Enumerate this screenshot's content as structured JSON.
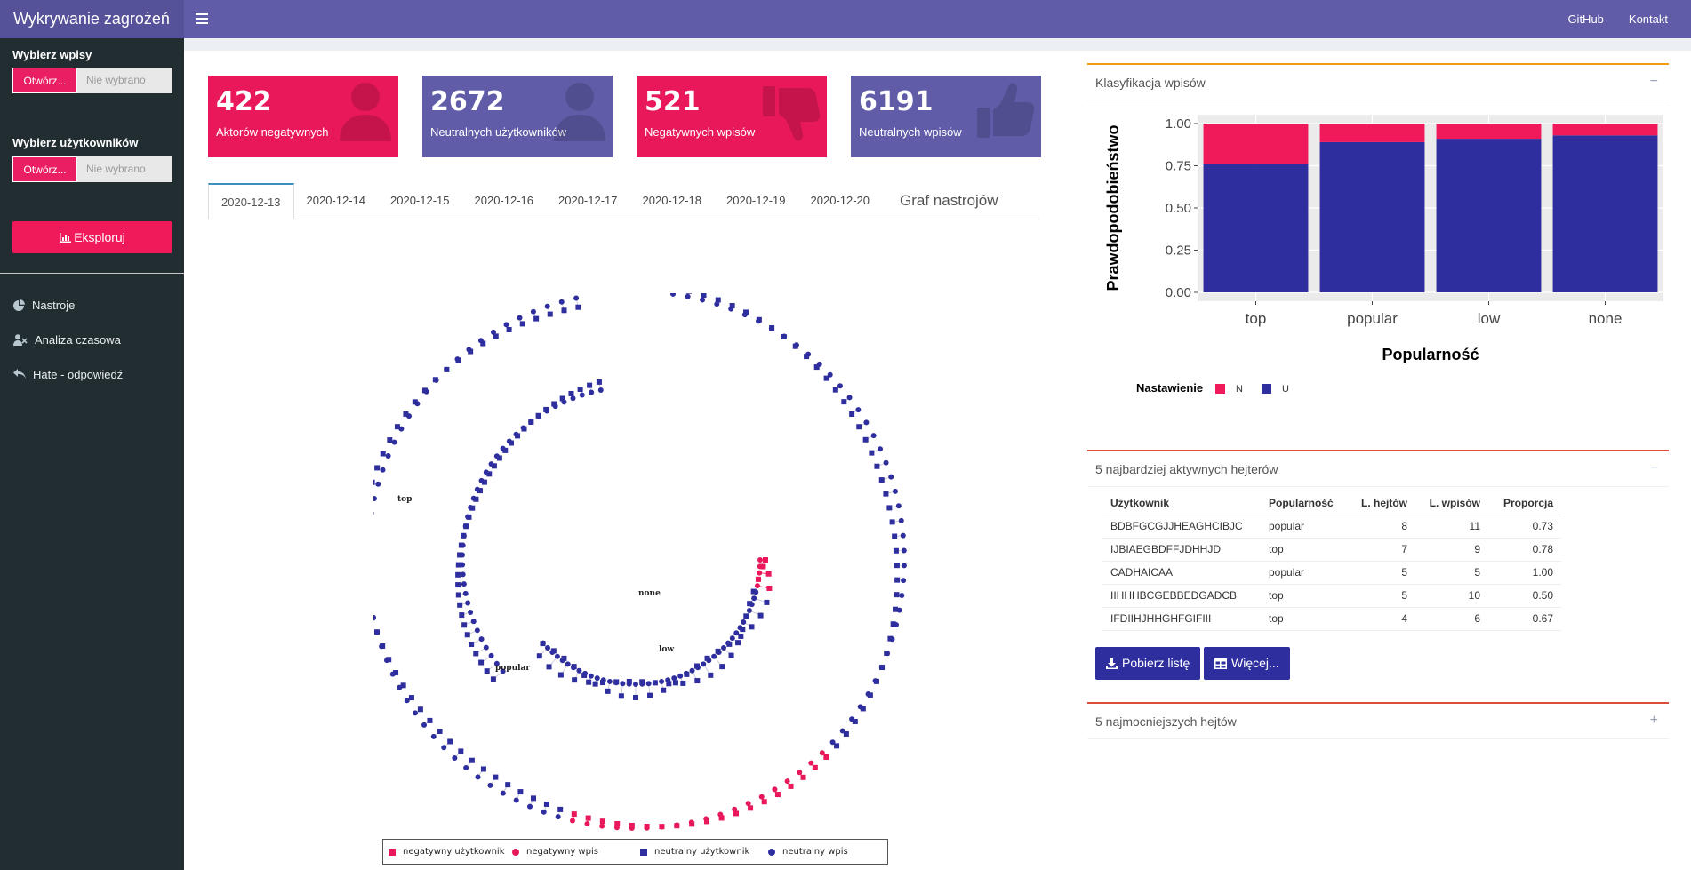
{
  "app": {
    "title": "Wykrywanie zagrożeń"
  },
  "nav": {
    "github": "GitHub",
    "contact": "Kontakt"
  },
  "sidebar": {
    "posts_label": "Wybierz wpisy",
    "posts_button": "Otwórz...",
    "posts_file": "Nie wybrano",
    "users_label": "Wybierz użytkowników",
    "users_button": "Otwórz...",
    "users_file": "Nie wybrano",
    "explore": "Eksploruj",
    "items": [
      {
        "label": "Nastroje",
        "icon": "pie-chart-icon"
      },
      {
        "label": "Analiza czasowa",
        "icon": "user-clock-icon"
      },
      {
        "label": "Hate - odpowiedź",
        "icon": "reply-icon"
      }
    ]
  },
  "stats": [
    {
      "value": "422",
      "label": "Aktorów negatywnych",
      "icon": "user-icon",
      "color": "#e8185a"
    },
    {
      "value": "2672",
      "label": "Neutralnych użytkowników",
      "icon": "user-icon",
      "color": "#605ca8"
    },
    {
      "value": "521",
      "label": "Negatywnych wpisów",
      "icon": "thumbs-down-icon",
      "color": "#e8185a"
    },
    {
      "value": "6191",
      "label": "Neutralnych wpisów",
      "icon": "thumbs-up-icon",
      "color": "#605ca8"
    }
  ],
  "tabs": [
    "2020-12-13",
    "2020-12-14",
    "2020-12-15",
    "2020-12-16",
    "2020-12-17",
    "2020-12-18",
    "2020-12-19",
    "2020-12-20",
    "Graf nastrojów"
  ],
  "graph": {
    "labels": {
      "top": "top",
      "none": "none",
      "low": "low",
      "popular": "popular"
    },
    "legend": [
      "negatywny użytkownik",
      "negatywny wpis",
      "neutralny użytkownik",
      "neutralny wpis"
    ]
  },
  "classification_box": {
    "title": "Klasyfikacja wpisów"
  },
  "chart_data": {
    "type": "bar",
    "stacked": true,
    "categories": [
      "top",
      "popular",
      "low",
      "none"
    ],
    "series": [
      {
        "name": "U",
        "values": [
          0.76,
          0.89,
          0.91,
          0.93
        ],
        "color": "#2e2e9e"
      },
      {
        "name": "N",
        "values": [
          0.24,
          0.11,
          0.09,
          0.07
        ],
        "color": "#f0195a"
      }
    ],
    "xlabel": "Popularność",
    "ylabel": "Prawdopodobieństwo",
    "ylim": [
      0,
      1
    ],
    "yticks": [
      "0.00",
      "0.25",
      "0.50",
      "0.75",
      "1.00"
    ],
    "legend_title": "Nastawienie",
    "legend_position": "bottom",
    "grid": true
  },
  "haters_box": {
    "title": "5 najbardziej aktywnych hejterów",
    "columns": [
      "Użytkownik",
      "Popularność",
      "L. hejtów",
      "L. wpisów",
      "Proporcja"
    ],
    "rows": [
      [
        "BDBFGCGJJHEAGHCIBJC",
        "popular",
        "8",
        "11",
        "0.73"
      ],
      [
        "IJBIAEGBDFFJDHHJD",
        "top",
        "7",
        "9",
        "0.78"
      ],
      [
        "CADHAICAA",
        "popular",
        "5",
        "5",
        "1.00"
      ],
      [
        "IIHHHBCGEBBEDGADCB",
        "top",
        "5",
        "10",
        "0.50"
      ],
      [
        "IFDIIHJHHGHFGIFIII",
        "top",
        "4",
        "6",
        "0.67"
      ]
    ],
    "download": "Pobierz listę",
    "more": "Więcej..."
  },
  "strongest_box": {
    "title": "5 najmocniejszych hejtów"
  }
}
